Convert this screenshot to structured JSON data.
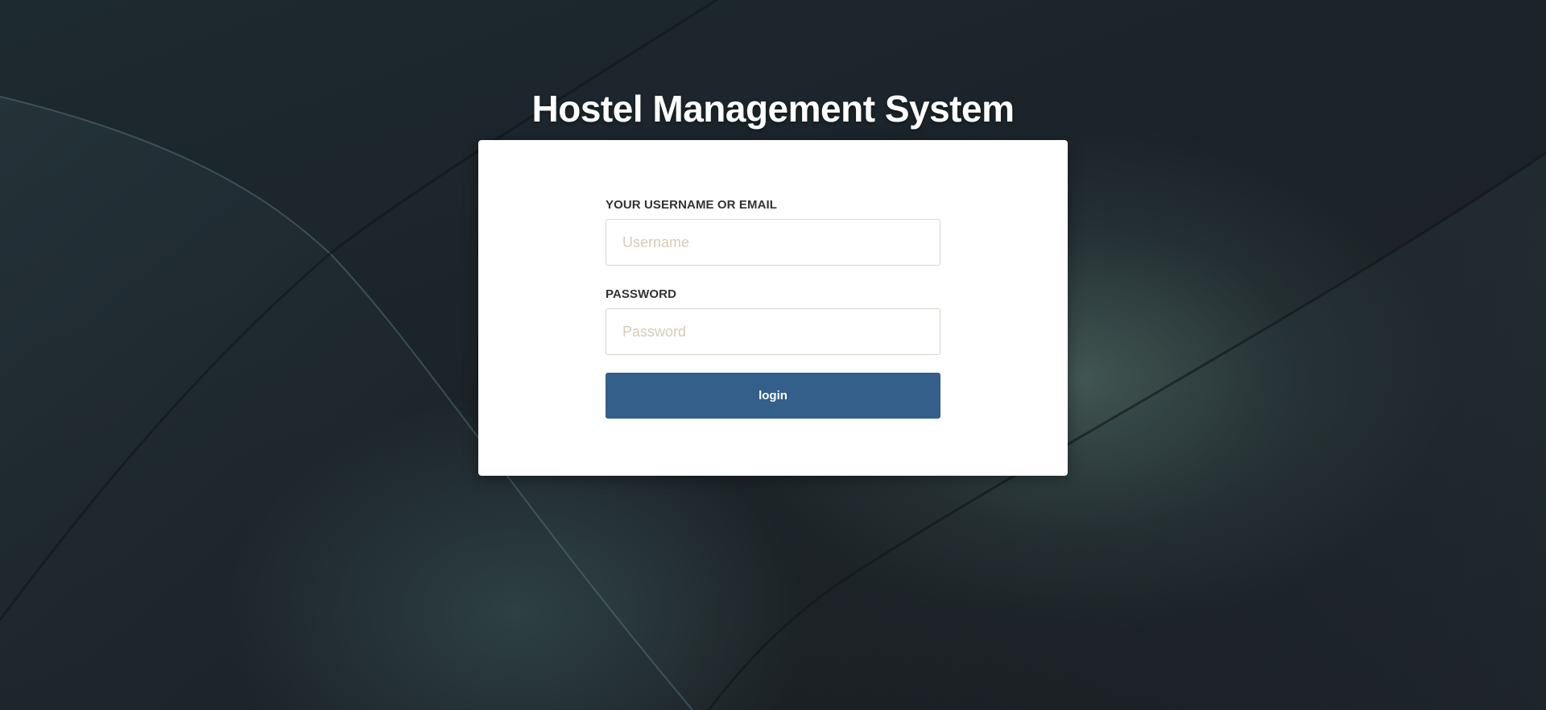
{
  "page": {
    "title": "Hostel Management System"
  },
  "login_form": {
    "username": {
      "label": "YOUR USERNAME OR EMAIL",
      "placeholder": "Username",
      "value": ""
    },
    "password": {
      "label": "PASSWORD",
      "placeholder": "Password",
      "value": ""
    },
    "submit_label": "login"
  },
  "colors": {
    "button": "#335f8a",
    "card": "#ffffff",
    "background": "#1b2329",
    "placeholder": "#d8cbb8"
  }
}
